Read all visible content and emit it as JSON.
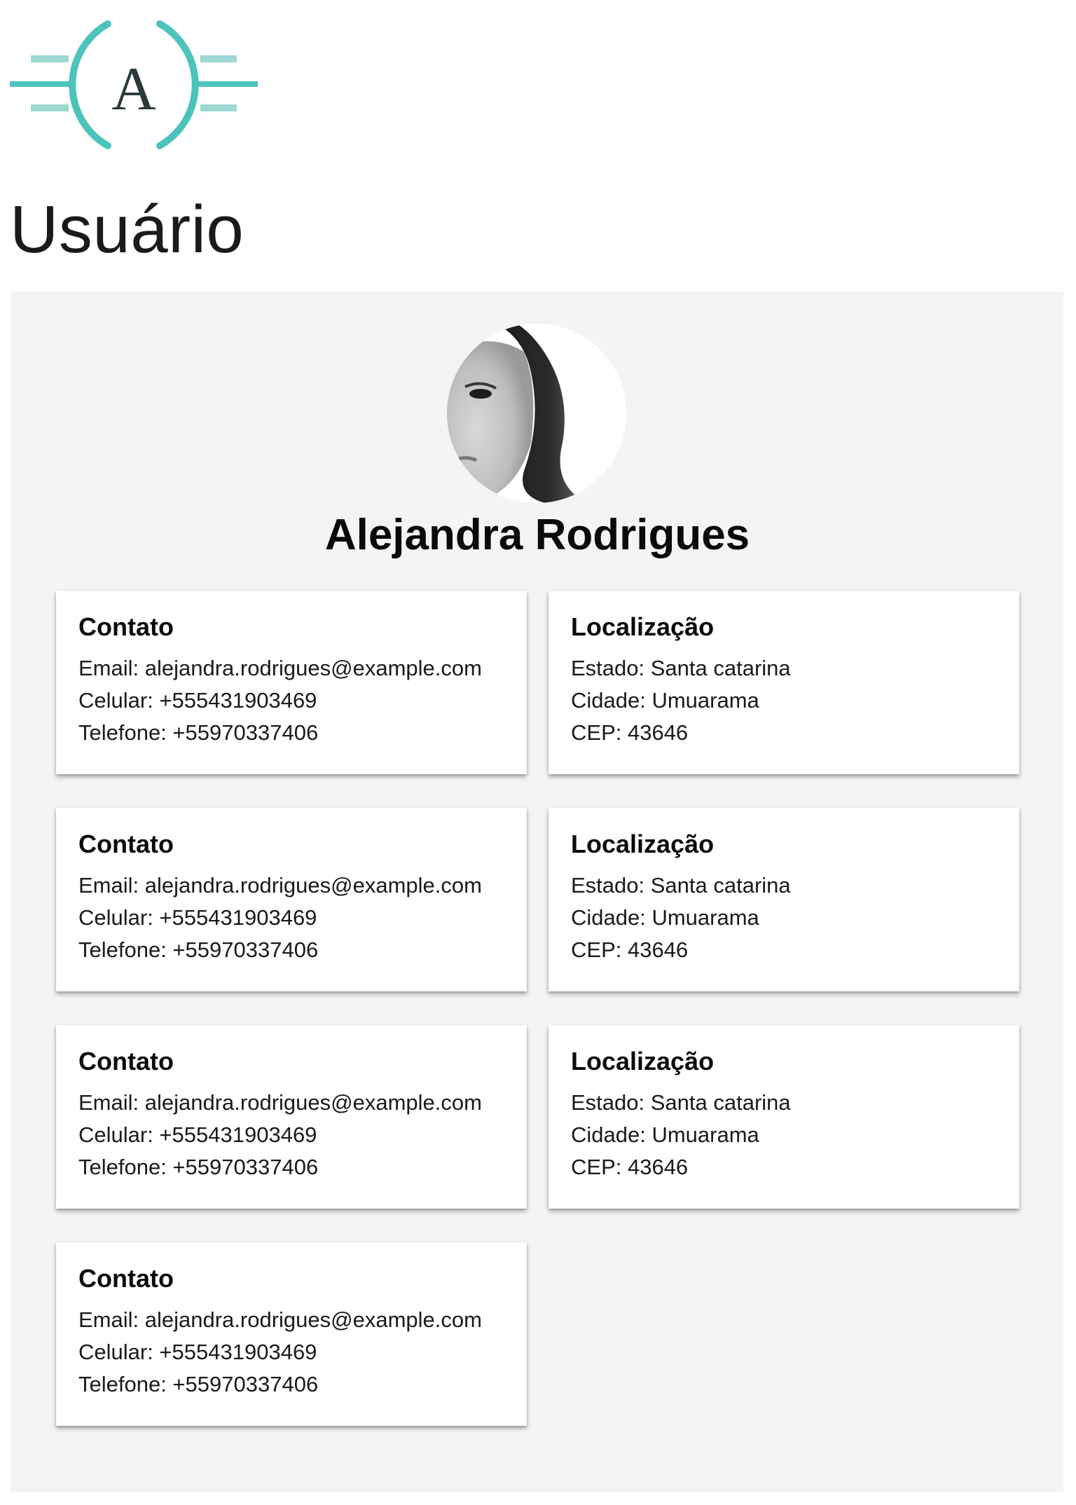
{
  "header": {
    "logo_letter": "A",
    "logo_color": "#4cc3bb",
    "page_title": "Usuário"
  },
  "profile": {
    "name": "Alejandra Rodrigues",
    "avatar_icon": "user-photo"
  },
  "cards": [
    {
      "type": "contact",
      "title": "Contato",
      "lines": [
        "Email: alejandra.rodrigues@example.com",
        "Celular: +555431903469",
        "Telefone: +55970337406"
      ]
    },
    {
      "type": "location",
      "title": "Localização",
      "lines": [
        "Estado: Santa catarina",
        "Cidade: Umuarama",
        "CEP: 43646"
      ]
    },
    {
      "type": "contact",
      "title": "Contato",
      "lines": [
        "Email: alejandra.rodrigues@example.com",
        "Celular: +555431903469",
        "Telefone: +55970337406"
      ]
    },
    {
      "type": "location",
      "title": "Localização",
      "lines": [
        "Estado: Santa catarina",
        "Cidade: Umuarama",
        "CEP: 43646"
      ]
    },
    {
      "type": "contact",
      "title": "Contato",
      "lines": [
        "Email: alejandra.rodrigues@example.com",
        "Celular: +555431903469",
        "Telefone: +55970337406"
      ]
    },
    {
      "type": "location",
      "title": "Localização",
      "lines": [
        "Estado: Santa catarina",
        "Cidade: Umuarama",
        "CEP: 43646"
      ]
    },
    {
      "type": "contact",
      "title": "Contato",
      "lines": [
        "Email: alejandra.rodrigues@example.com",
        "Celular: +555431903469",
        "Telefone: +55970337406"
      ]
    }
  ],
  "colors": {
    "panel_background": "#f4f4f4",
    "card_background": "#ffffff",
    "accent": "#4cc3bb"
  }
}
